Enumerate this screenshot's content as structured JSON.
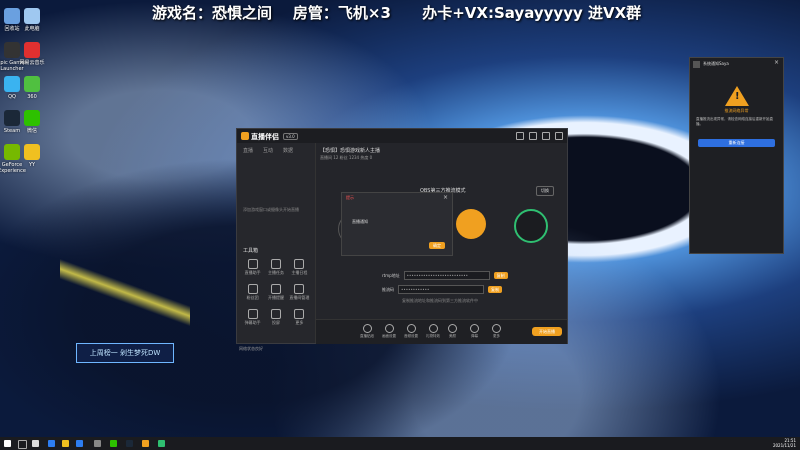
{
  "overlay": {
    "text": "游戏名：恐惧之间    房管：飞机×3      办卡+VX:Sayayyyyy 进VX群"
  },
  "desktop_icons": [
    {
      "label": "回收站",
      "color": "#6aa0e0"
    },
    {
      "label": "此电脑",
      "color": "#9fc8f0"
    },
    {
      "label": "Epic Games Launcher",
      "color": "#333"
    },
    {
      "label": "网易云音乐",
      "color": "#e03030"
    },
    {
      "label": "QQ",
      "color": "#3ab3f0"
    },
    {
      "label": "360",
      "color": "#50c040"
    },
    {
      "label": "Steam",
      "color": "#1b2838"
    },
    {
      "label": "微信",
      "color": "#2dc100"
    },
    {
      "label": "GeForce Experience",
      "color": "#76b900"
    },
    {
      "label": "YY",
      "color": "#f0c020"
    }
  ],
  "watermark": {
    "text": "上周榜一  剁生梦死DW"
  },
  "app": {
    "logo_text": "直播伴侣",
    "version": "v3.0",
    "left_tabs": [
      "直播",
      "互动",
      "数据"
    ],
    "left_hint": "添加游戏窗口或摄像头开始直播",
    "tools_title": "工具箱",
    "tools": [
      "直播助手",
      "主播任务",
      "主播日程",
      "粉丝团",
      "开播提醒",
      "直播间管理",
      "弹幕助手",
      "投屏",
      "更多"
    ],
    "room_title": "【恐惧】恐惧游戏新人主播",
    "room_meta": "直播间 12 粉丝 1234 热度 0",
    "mode_label": "OBS第三方推流模式",
    "switch_label": "切换",
    "rtmp_label": "rtmp地址",
    "rtmp_value": "••••••••••••••••••••••••••",
    "key_label": "推流码",
    "key_value": "••••••••••••",
    "copy_label": "复制",
    "hint": "复制推流地址和推流码到第三方推流软件中",
    "bottom_items": [
      "直播贴纸",
      "画面设置",
      "音频设置",
      "礼物特效",
      "美颜",
      "弹幕",
      "更多"
    ],
    "start_live": "开始直播",
    "status": "网络状态良好",
    "modal": {
      "title": "提示",
      "body": "直播通知",
      "ok": "确定"
    }
  },
  "popup": {
    "title": "系统通知Saya",
    "warn_title": "推流网络异常",
    "desc": "直播推流出现异常，请检查网络连接后重新开始直播。",
    "button": "重新连接"
  },
  "taskbar": {
    "time": "21:51",
    "date": "2021/11/21"
  }
}
